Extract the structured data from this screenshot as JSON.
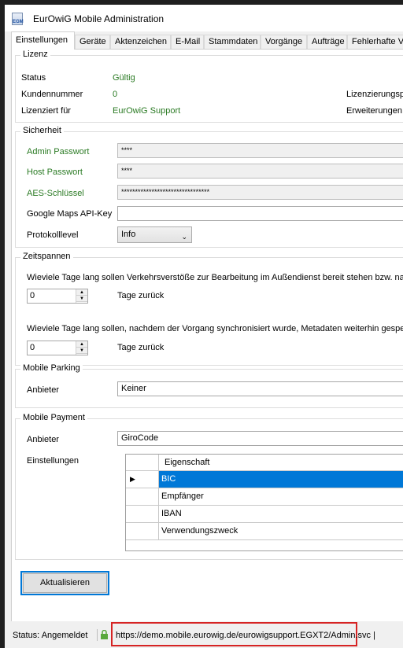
{
  "window": {
    "title": "EurOwiG Mobile Administration",
    "icon_text": "EGM"
  },
  "tabs": [
    {
      "label": "Einstellungen"
    },
    {
      "label": "Geräte"
    },
    {
      "label": "Aktenzeichen"
    },
    {
      "label": "E-Mail"
    },
    {
      "label": "Stammdaten"
    },
    {
      "label": "Vorgänge"
    },
    {
      "label": "Aufträge"
    },
    {
      "label": "Fehlerhafte Vor"
    }
  ],
  "lizenz": {
    "title": "Lizenz",
    "status_label": "Status",
    "status_value": "Gültig",
    "kunde_label": "Kundennummer",
    "kunde_value": "0",
    "lizenziert_label": "Lizenziert für",
    "lizenziert_value": "EurOwiG Support",
    "zeitraum_label": "Lizenzierungspa",
    "erweiterungen_label": "Erweiterungen"
  },
  "sicherheit": {
    "title": "Sicherheit",
    "admin_label": "Admin Passwort",
    "admin_value": "****",
    "host_label": "Host Passwort",
    "host_value": "****",
    "aes_label": "AES-Schlüssel",
    "aes_value": "********************************",
    "maps_label": "Google Maps API-Key",
    "maps_value": "",
    "log_label": "Protokolllevel",
    "log_value": "Info"
  },
  "zeitspannen": {
    "title": "Zeitspannen",
    "q1": "Wieviele Tage lang sollen Verkehrsverstöße zur Bearbeitung im Außendienst bereit stehen bzw. nach",
    "v1": "0",
    "unit1": "Tage zurück",
    "q2": "Wieviele Tage lang sollen, nachdem der Vorgang synchronisiert wurde,  Metadaten weiterhin gespeich",
    "v2": "0",
    "unit2": "Tage zurück"
  },
  "parking": {
    "title": "Mobile Parking",
    "anbieter_label": "Anbieter",
    "anbieter_value": "Keiner"
  },
  "payment": {
    "title": "Mobile Payment",
    "anbieter_label": "Anbieter",
    "anbieter_value": "GiroCode",
    "einstellungen_label": "Einstellungen",
    "grid_header": "Eigenschaft",
    "rows": [
      {
        "value": "BIC",
        "selected": true,
        "marker": "▶"
      },
      {
        "value": "Empfänger",
        "selected": false,
        "marker": ""
      },
      {
        "value": "IBAN",
        "selected": false,
        "marker": ""
      },
      {
        "value": "Verwendungszweck",
        "selected": false,
        "marker": ""
      }
    ]
  },
  "button": {
    "label": "Aktualisieren"
  },
  "statusbar": {
    "status": "Status: Angemeldet",
    "url": "https://demo.mobile.eurowig.de/eurowigsupport.EGXT2/Admin.svc |"
  },
  "colors": {
    "accent": "#0078d7",
    "green_text": "#2a7a23",
    "highlight_box": "#d62424"
  }
}
